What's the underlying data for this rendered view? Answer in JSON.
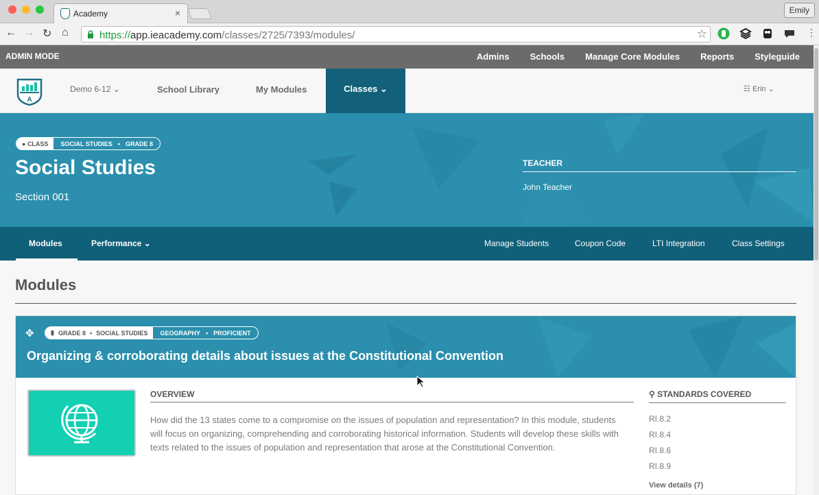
{
  "browser": {
    "tab_title": "Academy",
    "tab_close": "×",
    "user_button": "Emily",
    "url_scheme": "https://",
    "url_host": "app.ieacademy.com",
    "url_path": "/classes/2725/7393/modules/"
  },
  "admin_bar": {
    "label": "ADMIN MODE",
    "links": [
      "Admins",
      "Schools",
      "Manage Core Modules",
      "Reports",
      "Styleguide"
    ]
  },
  "main_nav": {
    "logo_letter": "A",
    "school_select": "Demo 6-12",
    "items": [
      "School Library",
      "My Modules"
    ],
    "active": "Classes",
    "user": "Erin"
  },
  "hero": {
    "pill_label": "CLASS",
    "pill_subject": "SOCIAL STUDIES",
    "pill_grade": "GRADE 8",
    "title": "Social Studies",
    "section": "Section 001",
    "teacher_heading": "TEACHER",
    "teacher_name": "John Teacher"
  },
  "subnav": {
    "left": [
      "Modules",
      "Performance"
    ],
    "right": [
      "Manage Students",
      "Coupon Code",
      "LTI Integration",
      "Class Settings"
    ]
  },
  "page": {
    "heading": "Modules"
  },
  "module": {
    "pill_grade": "GRADE 8",
    "pill_subject": "SOCIAL STUDIES",
    "pill_topic": "GEOGRAPHY",
    "pill_level": "PROFICIENT",
    "title": "Organizing & corroborating details about issues at the Constitutional Convention",
    "overview_heading": "OVERVIEW",
    "overview_text": "How did the 13 states come to a compromise on the issues of population and representation? In this module, students will focus on organizing, comprehending and corroborating historical information. Students will develop these skills with texts related to the issues of population and representation that arose at the Constitutional Convention.",
    "standards_heading": "STANDARDS COVERED",
    "standards": [
      "RI.8.2",
      "RI.8.4",
      "RI.8.6",
      "RI.8.9"
    ],
    "view_details": "View details (7)"
  },
  "colors": {
    "brand_teal": "#2b8fad",
    "dark_teal": "#11607a",
    "module_icon_bg": "#13d0b3",
    "admin_bar": "#6b6b6b"
  }
}
